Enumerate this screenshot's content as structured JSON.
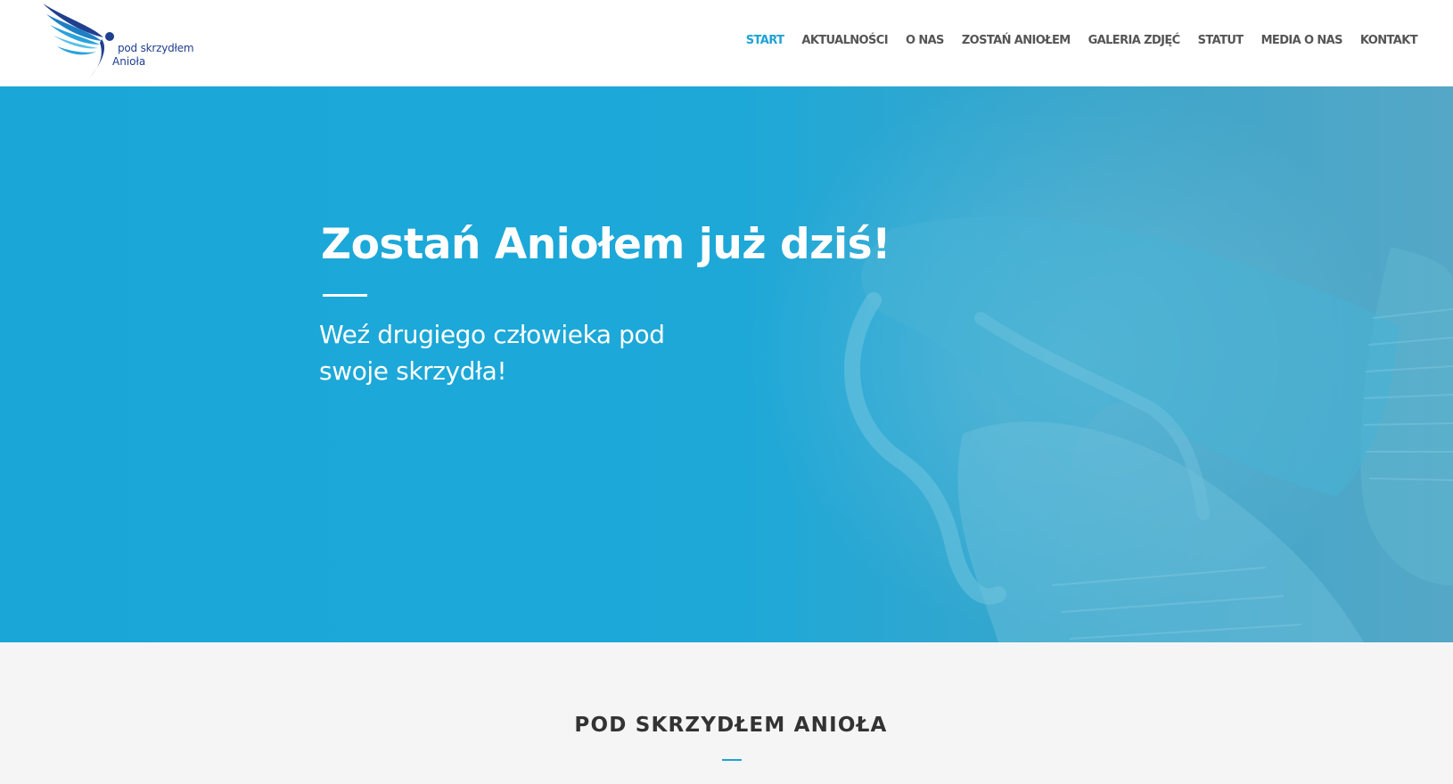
{
  "logo": {
    "line1": "pod skrzydłem",
    "line2": "Anioła"
  },
  "nav": {
    "items": [
      {
        "label": "START",
        "active": true
      },
      {
        "label": "AKTUALNOŚCI",
        "active": false
      },
      {
        "label": "O NAS",
        "active": false
      },
      {
        "label": "ZOSTAŃ ANIOŁEM",
        "active": false
      },
      {
        "label": "GALERIA ZDJĘĆ",
        "active": false
      },
      {
        "label": "STATUT",
        "active": false
      },
      {
        "label": "MEDIA O NAS",
        "active": false
      },
      {
        "label": "KONTAKT",
        "active": false
      }
    ]
  },
  "hero": {
    "title": "Zostań Aniołem już dziś!",
    "subtitle": "Weź drugiego człowieka pod swoje skrzydła!"
  },
  "section": {
    "title": "POD SKRZYDŁEM ANIOŁA"
  },
  "colors": {
    "accent": "#1ea3d6",
    "hero_bg": "#1aa7d8",
    "logo_dark": "#1f3f8f",
    "nav_text": "#555555",
    "section_bg": "#f5f5f5"
  }
}
